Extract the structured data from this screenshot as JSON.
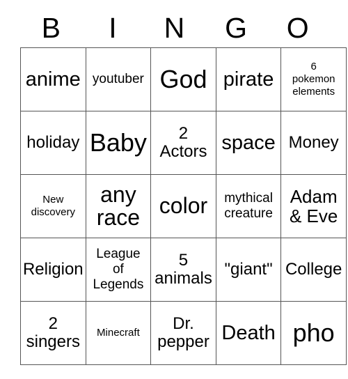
{
  "card": {
    "header": {
      "letters": [
        "B",
        "I",
        "N",
        "G",
        "O"
      ]
    },
    "grid": {
      "columns": 5,
      "rows": 5,
      "cells": [
        [
          {
            "text": "anime",
            "size": "fs-l"
          },
          {
            "text": "youtuber",
            "size": "fs-s"
          },
          {
            "text": "God",
            "size": "fs-xxl"
          },
          {
            "text": "pirate",
            "size": "fs-l"
          },
          {
            "text": "6\npokemon\nelements",
            "size": "fs-xs"
          }
        ],
        [
          {
            "text": "holiday",
            "size": "fs-m"
          },
          {
            "text": "Baby",
            "size": "fs-xxl"
          },
          {
            "text": "2\nActors",
            "size": "fs-m"
          },
          {
            "text": "space",
            "size": "fs-l"
          },
          {
            "text": "Money",
            "size": "fs-m"
          }
        ],
        [
          {
            "text": "New\ndiscovery",
            "size": "fs-xs"
          },
          {
            "text": "any\nrace",
            "size": "fs-xl"
          },
          {
            "text": "color",
            "size": "fs-xl"
          },
          {
            "text": "mythical\ncreature",
            "size": "fs-s"
          },
          {
            "text": "Adam\n& Eve",
            "size": "fs-ml"
          }
        ],
        [
          {
            "text": "Religion",
            "size": "fs-m"
          },
          {
            "text": "League\nof\nLegends",
            "size": "fs-s"
          },
          {
            "text": "5\nanimals",
            "size": "fs-m"
          },
          {
            "text": "\"giant\"",
            "size": "fs-m"
          },
          {
            "text": "College",
            "size": "fs-m"
          }
        ],
        [
          {
            "text": "2\nsingers",
            "size": "fs-m"
          },
          {
            "text": "Minecraft",
            "size": "fs-xs"
          },
          {
            "text": "Dr.\npepper",
            "size": "fs-m"
          },
          {
            "text": "Death",
            "size": "fs-l"
          },
          {
            "text": "pho",
            "size": "fs-xxl"
          }
        ]
      ]
    },
    "colors": {
      "background": "#ffffff",
      "text": "#000000",
      "border": "#555555"
    }
  }
}
